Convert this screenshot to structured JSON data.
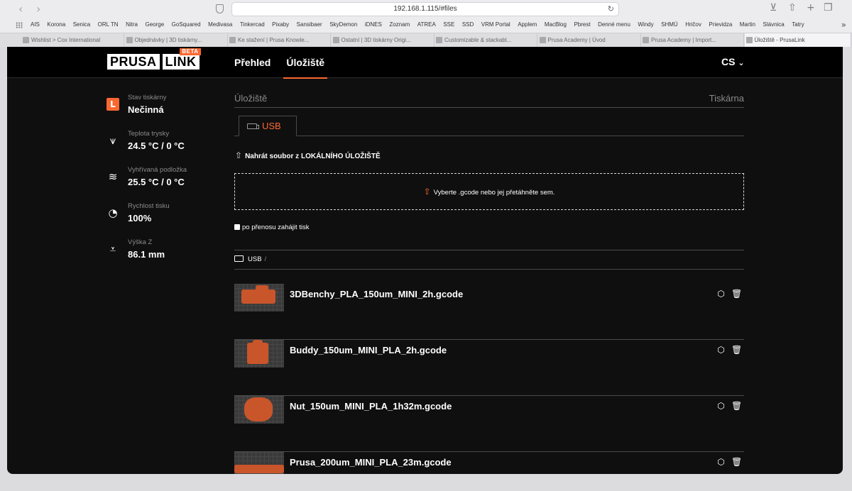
{
  "browser": {
    "url": "192.168.1.115/#files",
    "bookmarks": [
      "AIS",
      "Korona",
      "Senica",
      "ORL TN",
      "Nitra",
      "George",
      "GoSquared",
      "Medivasa",
      "Tinkercad",
      "Pixaby",
      "Sansibaer",
      "SkyDemon",
      "iDNES",
      "Zoznam",
      "ATREA",
      "SSE",
      "SSD",
      "VRM Portal",
      "Applem",
      "MacBlog",
      "Pbrest",
      "Denné menu",
      "Windy",
      "SHMÚ",
      "Hričov",
      "Prievidza",
      "Martin",
      "Slávnica",
      "Tatry"
    ],
    "tabs": [
      "Wishlist > Cox International",
      "Objednávky | 3D tiskárny...",
      "Ke stažení | Prusa Knowle...",
      "Ostatní | 3D tiskárny Origi...",
      "Customizable & stackabl...",
      "Prusa Academy | Úvod",
      "Prusa Academy | Import...",
      "Úložiště - PrusaLink"
    ]
  },
  "app": {
    "logo_left": "PRUSA",
    "logo_right": "LINK",
    "logo_badge": "BETA",
    "nav": [
      "Přehled",
      "Úložiště"
    ],
    "lang": "CS",
    "accent": "#fa6831"
  },
  "sidebar": [
    {
      "label": "Stav tiskárny",
      "value": "Nečinná",
      "icon": "printer-icon"
    },
    {
      "label": "Teplota trysky",
      "value": "24.5 °C / 0 °C",
      "icon": "nozzle-icon"
    },
    {
      "label": "Vyhřívaná podložka",
      "value": "25.5 °C / 0 °C",
      "icon": "heatbed-icon"
    },
    {
      "label": "Rychlost tisku",
      "value": "100%",
      "icon": "speed-icon"
    },
    {
      "label": "Výška Z",
      "value": "86.1 mm",
      "icon": "z-height-icon"
    }
  ],
  "storage": {
    "title": "Úložiště",
    "right_title": "Tiskárna",
    "tab": "USB",
    "upload_label": "Nahrát soubor z LOKÁLNÍHO ÚLOŽIŠTĚ",
    "dropzone_text": "Vyberte .gcode nebo jej přetáhněte sem.",
    "start_print_label": "po přenosu zahájit tisk",
    "path": "USB",
    "path_sep": "/"
  },
  "files": [
    {
      "name": "3DBenchy_PLA_150um_MINI_2h.gcode"
    },
    {
      "name": "Buddy_150um_MINI_PLA_2h.gcode"
    },
    {
      "name": "Nut_150um_MINI_PLA_1h32m.gcode"
    },
    {
      "name": "Prusa_200um_MINI_PLA_23m.gcode"
    }
  ]
}
